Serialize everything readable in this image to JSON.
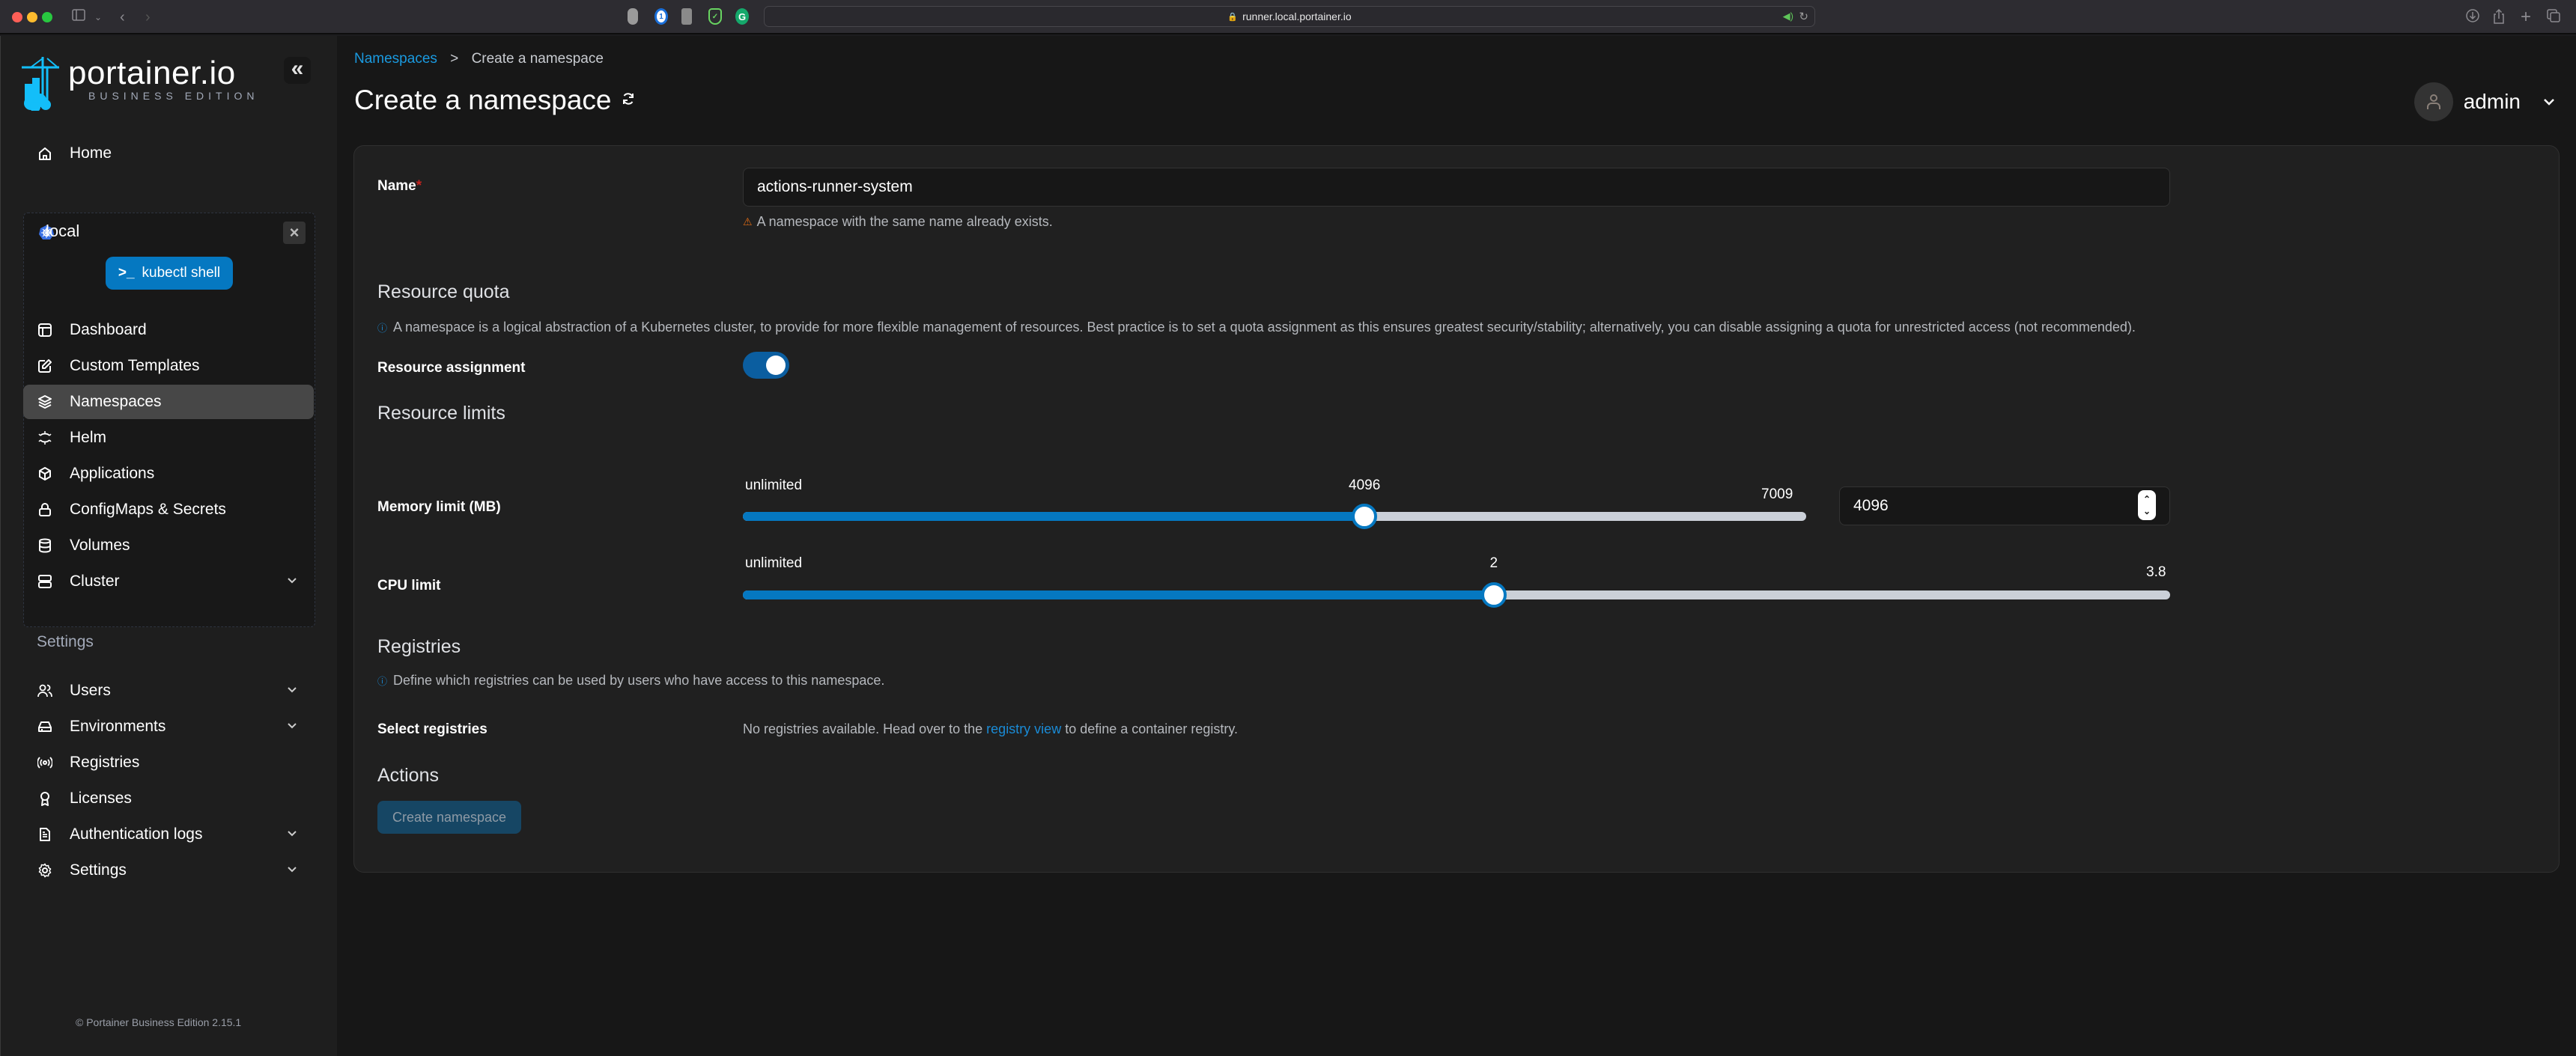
{
  "browser": {
    "url": "runner.local.portainer.io",
    "extensions": [
      "privacy-shield-icon",
      "1password-icon",
      "tampermonkey-icon",
      "adguard-icon",
      "grammarly-icon"
    ]
  },
  "sidebar": {
    "logo_word": "portainer.io",
    "logo_sub": "BUSINESS EDITION",
    "collapse_label": "«",
    "home": "Home",
    "environment": {
      "name": "local",
      "kubectl_button": "kubectl shell",
      "close_label": "×",
      "items": [
        {
          "label": "Dashboard",
          "icon": "dashboard-icon"
        },
        {
          "label": "Custom Templates",
          "icon": "edit-icon"
        },
        {
          "label": "Namespaces",
          "icon": "layers-icon",
          "active": true
        },
        {
          "label": "Helm",
          "icon": "helm-icon"
        },
        {
          "label": "Applications",
          "icon": "box-icon"
        },
        {
          "label": "ConfigMaps & Secrets",
          "icon": "lock-icon"
        },
        {
          "label": "Volumes",
          "icon": "database-icon"
        },
        {
          "label": "Cluster",
          "icon": "server-icon",
          "expandable": true
        }
      ]
    },
    "settings_heading": "Settings",
    "settings_items": [
      {
        "label": "Users",
        "icon": "users-icon",
        "expandable": true
      },
      {
        "label": "Environments",
        "icon": "hard-drive-icon",
        "expandable": true
      },
      {
        "label": "Registries",
        "icon": "radio-icon"
      },
      {
        "label": "Licenses",
        "icon": "award-icon"
      },
      {
        "label": "Authentication logs",
        "icon": "file-text-icon",
        "expandable": true
      },
      {
        "label": "Settings",
        "icon": "gear-icon",
        "expandable": true
      }
    ],
    "footer": "© Portainer Business Edition  2.15.1"
  },
  "header": {
    "breadcrumb_link": "Namespaces",
    "breadcrumb_sep": ">",
    "breadcrumb_current": "Create a namespace",
    "title": "Create a namespace",
    "user": "admin"
  },
  "form": {
    "name_label": "Name",
    "name_required": "*",
    "name_value": "actions-runner-system",
    "name_warning": "A namespace with the same name already exists.",
    "resource_quota_title": "Resource quota",
    "resource_quota_hint": "A namespace is a logical abstraction of a Kubernetes cluster, to provide for more flexible management of resources. Best practice is to set a quota assignment as this ensures greatest security/stability; alternatively, you can disable assigning a quota for unrestricted access (not recommended).",
    "resource_assignment_label": "Resource assignment",
    "resource_assignment_enabled": true,
    "resource_limits_title": "Resource limits",
    "memory": {
      "label": "Memory limit (MB)",
      "min_label": "unlimited",
      "value_label": "4096",
      "max_label": "7009",
      "value": 4096,
      "min": 0,
      "max": 7009,
      "input_value": "4096"
    },
    "cpu": {
      "label": "CPU limit",
      "min_label": "unlimited",
      "value_label": "2",
      "max_label": "3.8",
      "value": 2,
      "min": 0,
      "max": 3.8
    },
    "registries_title": "Registries",
    "registries_hint": "Define which registries can be used by users who have access to this namespace.",
    "select_registries_label": "Select registries",
    "registries_msg_pre": "No registries available. Head over to the ",
    "registries_msg_link": "registry view",
    "registries_msg_post": " to define a container registry.",
    "actions_title": "Actions",
    "create_button": "Create namespace"
  }
}
